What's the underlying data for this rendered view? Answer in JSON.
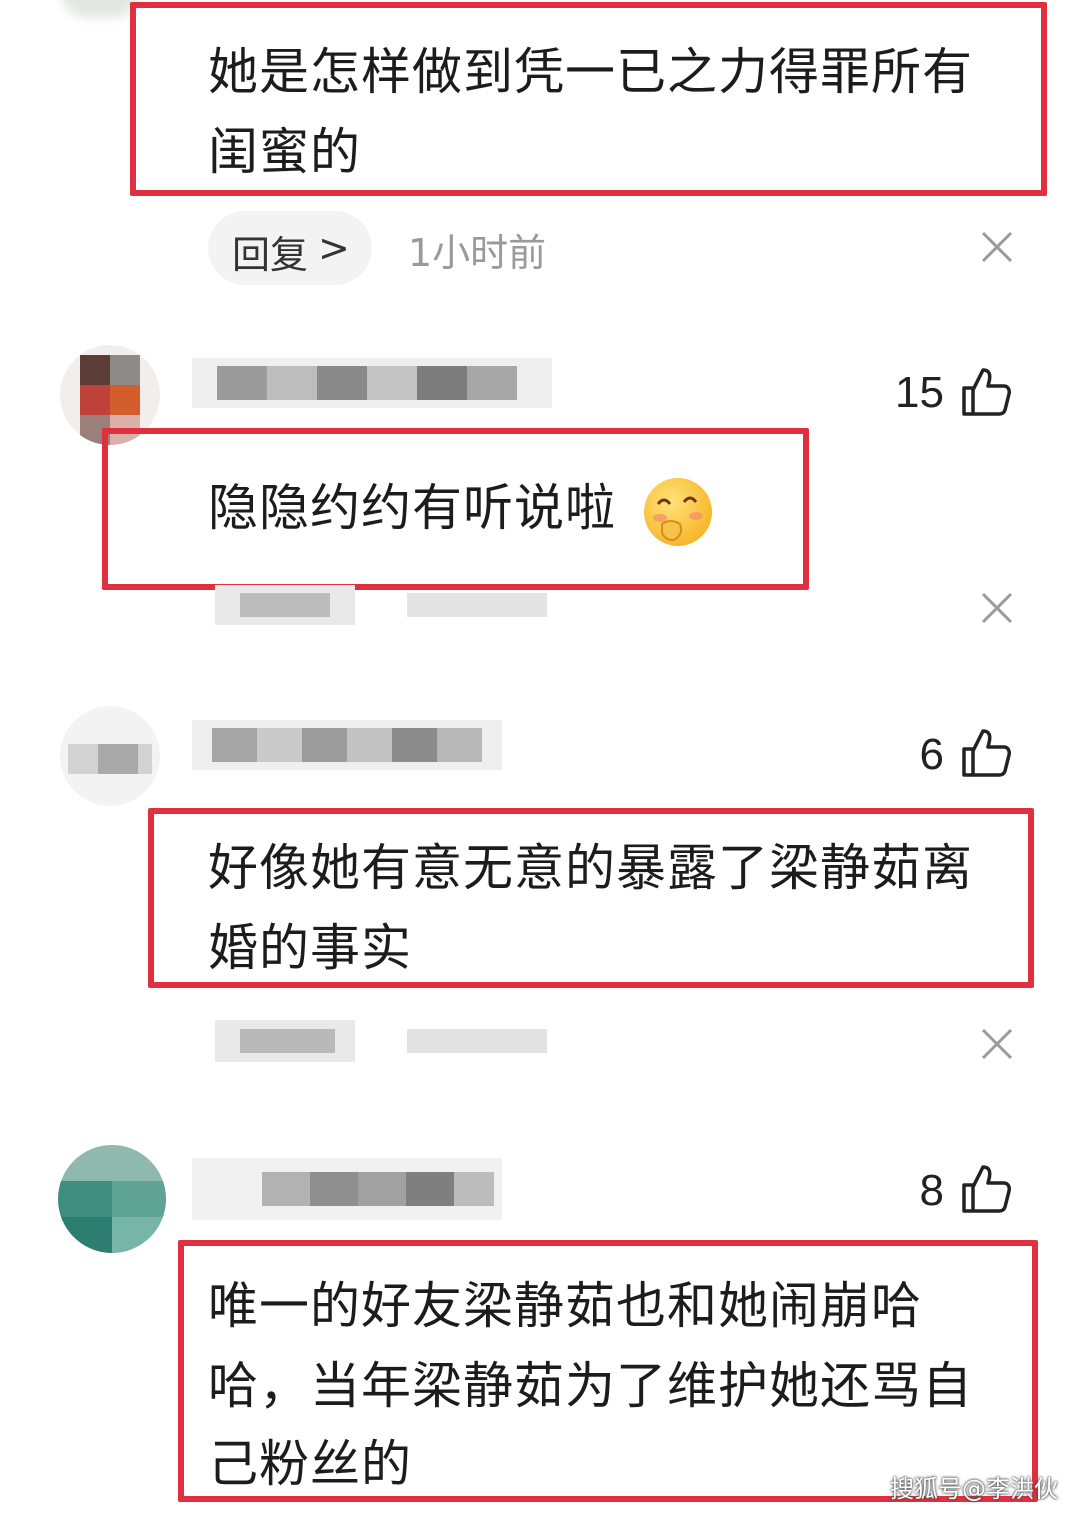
{
  "comments": [
    {
      "lines": [
        "她是怎样做到凭一已之力得罪所有",
        "闺蜜的"
      ],
      "reply_label": "回复",
      "reply_chevron": ">",
      "time": "1小时前",
      "close_icon": "close-icon"
    },
    {
      "likes": "15",
      "lines": [
        "隐隐约约有听说啦"
      ],
      "emoji": "shy-smile-emoji",
      "close_icon": "close-icon"
    },
    {
      "likes": "6",
      "lines": [
        "好像她有意无意的暴露了梁静茹离",
        "婚的事实"
      ],
      "close_icon": "close-icon"
    },
    {
      "likes": "8",
      "lines": [
        "唯一的好友梁静茹也和她闹崩哈",
        "哈，当年梁静茹为了维护她还骂自",
        "己粉丝的"
      ]
    }
  ],
  "watermark": "搜狐号@李洪伙",
  "colors": {
    "highlight_box": "#e0303f",
    "text": "#1c1c1c",
    "meta_text": "#9a9a9a",
    "pill_bg": "#f3f3f3"
  },
  "icons": [
    "thumbs-up-icon",
    "close-icon",
    "avatar",
    "chevron-right-icon"
  ]
}
